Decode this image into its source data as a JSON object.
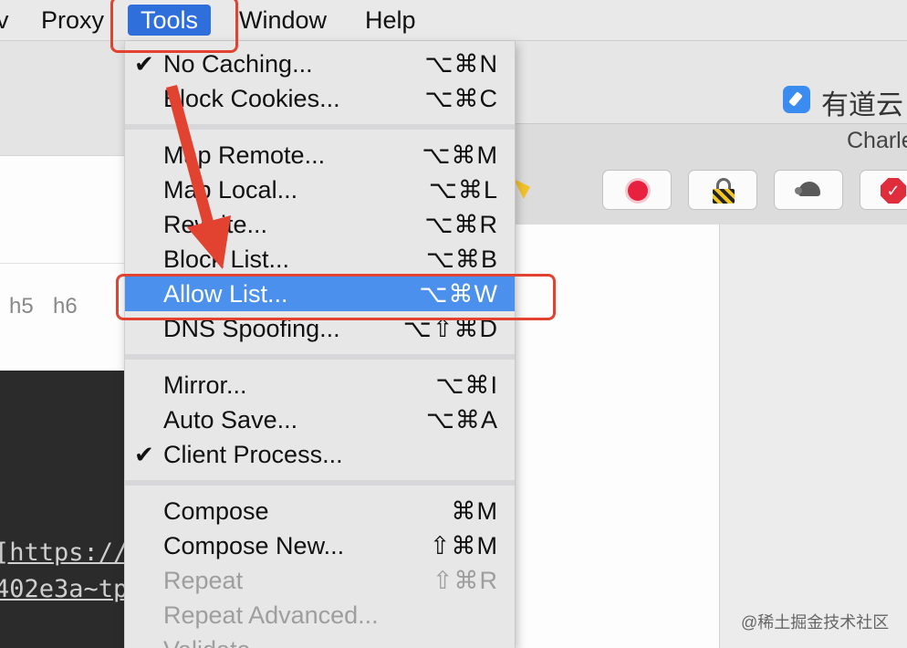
{
  "menubar": {
    "items": [
      "v",
      "Proxy",
      "Tools",
      "Window",
      "Help"
    ]
  },
  "menu": {
    "items": [
      {
        "check": "✔",
        "label": "No Caching...",
        "shortcut": "⌥⌘N"
      },
      {
        "check": "",
        "label": "Block Cookies...",
        "shortcut": "⌥⌘C"
      },
      {
        "check": "",
        "label": "Map Remote...",
        "shortcut": "⌥⌘M"
      },
      {
        "check": "",
        "label": "Map Local...",
        "shortcut": "⌥⌘L"
      },
      {
        "check": "",
        "label": "Rewrite...",
        "shortcut": "⌥⌘R"
      },
      {
        "check": "",
        "label": "Block List...",
        "shortcut": "⌥⌘B"
      },
      {
        "check": "",
        "label": "Allow List...",
        "shortcut": "⌥⌘W"
      },
      {
        "check": "",
        "label": "DNS Spoofing...",
        "shortcut": "⌥⇧⌘D"
      },
      {
        "check": "",
        "label": "Mirror...",
        "shortcut": "⌥⌘I"
      },
      {
        "check": "",
        "label": "Auto Save...",
        "shortcut": "⌥⌘A"
      },
      {
        "check": "✔",
        "label": "Client Process...",
        "shortcut": ""
      },
      {
        "check": "",
        "label": "Compose",
        "shortcut": "⌘M"
      },
      {
        "check": "",
        "label": "Compose New...",
        "shortcut": "⇧⌘M"
      },
      {
        "check": "",
        "label": "Repeat",
        "shortcut": "⇧⌘R"
      },
      {
        "check": "",
        "label": "Repeat Advanced...",
        "shortcut": ""
      },
      {
        "check": "",
        "label": "Validate",
        "shortcut": ""
      }
    ]
  },
  "background": {
    "heading_labels": [
      "h5",
      "h6"
    ],
    "code_lines": [
      "[https://",
      "402e3a~tp"
    ],
    "youdao_text": "有道云",
    "charles_title": "Charle",
    "watermark": "@稀土掘金技术社区"
  },
  "colors": {
    "menu_highlight": "#4a90ec",
    "menubar_active": "#2f6fdc",
    "annotation_red": "#e24331"
  }
}
